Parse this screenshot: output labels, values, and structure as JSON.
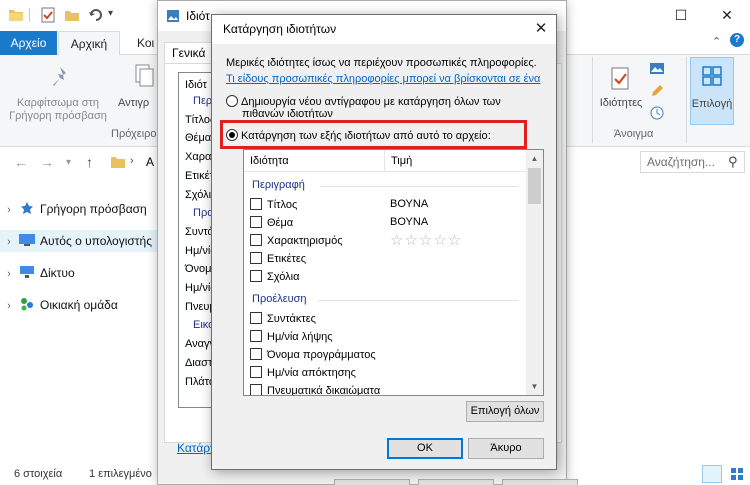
{
  "explorer": {
    "tabs": {
      "file": "Αρχείο",
      "home": "Αρχική",
      "share": "Κοι"
    },
    "ribbon": {
      "pin_label_1": "Καρφίτσωμα στη",
      "pin_label_2": "Γρήγορη πρόσβαση",
      "copy_label": "Αντιγρ",
      "clipboard_group": "Πρόχειρο",
      "properties_label": "Ιδιότητες",
      "open_group": "Άνοιγμα",
      "select_label": "Επιλογή"
    },
    "address_partial": "Α",
    "search_placeholder": "Αναζήτηση...",
    "tree": [
      {
        "label": "Γρήγορη πρόσβαση",
        "icon": "star-icon"
      },
      {
        "label": "Αυτός ο υπολογιστής",
        "icon": "computer-icon"
      },
      {
        "label": "Δίκτυο",
        "icon": "network-icon"
      },
      {
        "label": "Οικιακή ομάδα",
        "icon": "homegroup-icon"
      }
    ],
    "status": {
      "items": "6 στοιχεία",
      "selected": "1 επιλεγμένο"
    }
  },
  "props_window": {
    "title": "Ιδιότ",
    "tab": "Γενικά",
    "list_header": "Ιδιότ",
    "list_items": [
      {
        "label": "Περι",
        "cat": true
      },
      {
        "label": "Τίτλος",
        "cat": false
      },
      {
        "label": "Θέμα",
        "cat": false
      },
      {
        "label": "Χαρακ",
        "cat": false
      },
      {
        "label": "Ετικέτ",
        "cat": false
      },
      {
        "label": "Σχόλια",
        "cat": false
      },
      {
        "label": "Προε",
        "cat": true
      },
      {
        "label": "Συντά",
        "cat": false
      },
      {
        "label": "Ημ/νία",
        "cat": false
      },
      {
        "label": "Όνομα",
        "cat": false
      },
      {
        "label": "Ημ/νία",
        "cat": false
      },
      {
        "label": "Πνευμ",
        "cat": false
      },
      {
        "label": "Εικό",
        "cat": true
      },
      {
        "label": "Αναγν",
        "cat": false
      },
      {
        "label": "Διαστ",
        "cat": false
      },
      {
        "label": "Πλάτο",
        "cat": false
      }
    ],
    "remove_link": "Κατάργ"
  },
  "dialog": {
    "title": "Κατάργηση ιδιοτήτων",
    "info": "Μερικές ιδιότητες ίσως να περιέχουν προσωπικές πληροφορίες.",
    "link": "Τι είδους προσωπικές πληροφορίες μπορεί να βρίσκονται σε ένα",
    "option_copy_1": "Δημιουργία νέου αντίγραφου με κατάργηση όλων των",
    "option_copy_2": "πιθανών ιδιοτήτων",
    "option_remove": "Κατάργηση των εξής ιδιοτήτων από αυτό το αρχείο:",
    "col_property": "Ιδιότητα",
    "col_value": "Τιμή",
    "group_description": "Περιγραφή",
    "group_origin": "Προέλευση",
    "rows_description": [
      {
        "label": "Τίτλος",
        "value": "ΒΟΥΝΑ"
      },
      {
        "label": "Θέμα",
        "value": "ΒΟΥΝΑ"
      },
      {
        "label": "Χαρακτηρισμός",
        "value": ""
      },
      {
        "label": "Ετικέτες",
        "value": ""
      },
      {
        "label": "Σχόλια",
        "value": ""
      }
    ],
    "rows_origin": [
      {
        "label": "Συντάκτες"
      },
      {
        "label": "Ημ/νία λήψης"
      },
      {
        "label": "Όνομα προγράμματος"
      },
      {
        "label": "Ημ/νία απόκτησης"
      },
      {
        "label": "Πνευματικά δικαιώματα"
      }
    ],
    "rating_stars": "☆☆☆☆☆",
    "select_all": "Επιλογή όλων",
    "ok": "OK",
    "cancel": "Άκυρο"
  }
}
